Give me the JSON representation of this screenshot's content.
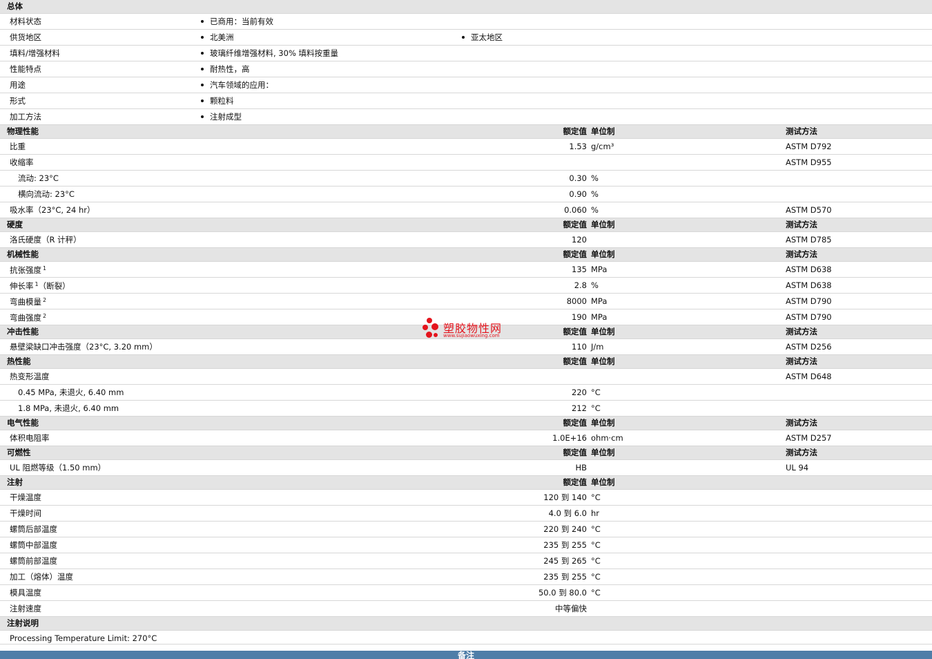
{
  "header_labels": {
    "nominal": "额定值",
    "unit": "单位制",
    "test_method": "测试方法"
  },
  "sections": [
    {
      "type": "general",
      "title": "总体",
      "rows": [
        {
          "label": "材料状态",
          "values": [
            "已商用：当前有效"
          ]
        },
        {
          "label": "供货地区",
          "values": [
            "北美洲",
            "亚太地区"
          ]
        },
        {
          "label": "填料/增强材料",
          "values": [
            "玻璃纤维增强材料, 30% 填料按重量"
          ]
        },
        {
          "label": "性能特点",
          "values": [
            "耐热性，高"
          ]
        },
        {
          "label": "用途",
          "values": [
            "汽车领域的应用："
          ]
        },
        {
          "label": "形式",
          "values": [
            "颗粒料"
          ]
        },
        {
          "label": "加工方法",
          "values": [
            "注射成型"
          ]
        }
      ]
    },
    {
      "type": "prop",
      "title": "物理性能",
      "show_test": true,
      "rows": [
        {
          "label": "比重",
          "nominal": "1.53",
          "unit": "g/cm³",
          "test": "ASTM D792"
        },
        {
          "label": "收缩率",
          "nominal": "",
          "unit": "",
          "test": "ASTM D955"
        },
        {
          "label": "流动: 23°C",
          "sub": true,
          "nominal": "0.30",
          "unit": "%",
          "test": ""
        },
        {
          "label": "横向流动: 23°C",
          "sub": true,
          "nominal": "0.90",
          "unit": "%",
          "test": ""
        },
        {
          "label": "吸水率（23°C, 24 hr）",
          "nominal": "0.060",
          "unit": "%",
          "test": "ASTM D570"
        }
      ]
    },
    {
      "type": "prop",
      "title": "硬度",
      "show_test": true,
      "rows": [
        {
          "label": "洛氏硬度（R 计秤）",
          "nominal": "120",
          "unit": "",
          "test": "ASTM D785"
        }
      ]
    },
    {
      "type": "prop",
      "title": "机械性能",
      "show_test": true,
      "rows": [
        {
          "label": "抗张强度",
          "sup": "1",
          "nominal": "135",
          "unit": "MPa",
          "test": "ASTM D638"
        },
        {
          "label": "伸长率",
          "sup": "1",
          "label_tail": "（断裂）",
          "nominal": "2.8",
          "unit": "%",
          "test": "ASTM D638"
        },
        {
          "label": "弯曲模量",
          "sup": "2",
          "nominal": "8000",
          "unit": "MPa",
          "test": "ASTM D790"
        },
        {
          "label": "弯曲强度",
          "sup": "2",
          "nominal": "190",
          "unit": "MPa",
          "test": "ASTM D790"
        }
      ]
    },
    {
      "type": "prop",
      "title": "冲击性能",
      "show_test": true,
      "rows": [
        {
          "label": "悬壁梁缺口冲击强度（23°C, 3.20 mm）",
          "nominal": "110",
          "unit": "J/m",
          "test": "ASTM D256"
        }
      ]
    },
    {
      "type": "prop",
      "title": "热性能",
      "show_test": true,
      "rows": [
        {
          "label": "热变形温度",
          "nominal": "",
          "unit": "",
          "test": "ASTM D648"
        },
        {
          "label": "0.45 MPa, 未退火, 6.40 mm",
          "sub": true,
          "nominal": "220",
          "unit": "°C",
          "test": ""
        },
        {
          "label": "1.8 MPa, 未退火, 6.40 mm",
          "sub": true,
          "nominal": "212",
          "unit": "°C",
          "test": ""
        }
      ]
    },
    {
      "type": "prop",
      "title": "电气性能",
      "show_test": true,
      "rows": [
        {
          "label": "体积电阻率",
          "nominal": "1.0E+16",
          "unit": "ohm·cm",
          "test": "ASTM D257"
        }
      ]
    },
    {
      "type": "prop",
      "title": "可燃性",
      "show_test": true,
      "rows": [
        {
          "label": "UL 阻燃等级（1.50 mm）",
          "nominal": "HB",
          "unit": "",
          "test": "UL 94"
        }
      ]
    },
    {
      "type": "prop",
      "title": "注射",
      "show_test": false,
      "rows": [
        {
          "label": "干燥温度",
          "nominal": "120 到  140",
          "unit": "°C",
          "test": ""
        },
        {
          "label": "干燥时间",
          "nominal": "4.0 到  6.0",
          "unit": "hr",
          "test": ""
        },
        {
          "label": "螺筒后部温度",
          "nominal": "220 到  240",
          "unit": "°C",
          "test": ""
        },
        {
          "label": "螺筒中部温度",
          "nominal": "235 到  255",
          "unit": "°C",
          "test": ""
        },
        {
          "label": "螺筒前部温度",
          "nominal": "245 到  265",
          "unit": "°C",
          "test": ""
        },
        {
          "label": "加工（熔体）温度",
          "nominal": "235 到  255",
          "unit": "°C",
          "test": ""
        },
        {
          "label": "模具温度",
          "nominal": "50.0 到  80.0",
          "unit": "°C",
          "test": ""
        },
        {
          "label": "注射速度",
          "nominal": "中等偏快",
          "unit": "",
          "test": ""
        }
      ]
    },
    {
      "type": "note",
      "title": "注射说明",
      "rows": [
        {
          "label": "Processing Temperature Limit: 270°C"
        }
      ]
    }
  ],
  "notes_bar": {
    "title": "备注"
  },
  "watermark": {
    "name": "塑胶物性网",
    "url": "www.sujiaowuxing.com",
    "color": "#e4141d"
  }
}
